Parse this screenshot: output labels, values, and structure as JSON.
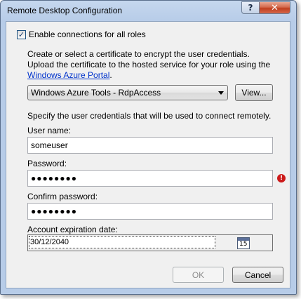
{
  "window": {
    "title": "Remote Desktop Configuration",
    "help_label": "?",
    "close_label": "✕"
  },
  "enable": {
    "label": "Enable connections for all roles",
    "checked": true,
    "check_glyph": "✓"
  },
  "certificate": {
    "instructions_line1": "Create or select a certificate to encrypt the user credentials.",
    "instructions_line2": "Upload the certificate to the hosted service for your role using the",
    "portal_link": "Windows Azure Portal",
    "portal_suffix": ".",
    "selected": "Windows Azure Tools - RdpAccess",
    "view_button": "View..."
  },
  "credentials": {
    "instructions": "Specify the user credentials that will be used to connect remotely.",
    "username_label": "User name:",
    "username_value": "someuser",
    "password_label": "Password:",
    "password_value": "●●●●●●●●",
    "password_error_icon": "!",
    "confirm_label": "Confirm password:",
    "confirm_value": "●●●●●●●●",
    "expiration_label": "Account expiration date:",
    "expiration_value": "30/12/2040",
    "calendar_day": "15"
  },
  "buttons": {
    "ok": "OK",
    "ok_enabled": false,
    "cancel": "Cancel"
  },
  "colors": {
    "accent_link": "#0033cc",
    "error": "#cc1a1a",
    "close_button": "#c03f1f"
  }
}
